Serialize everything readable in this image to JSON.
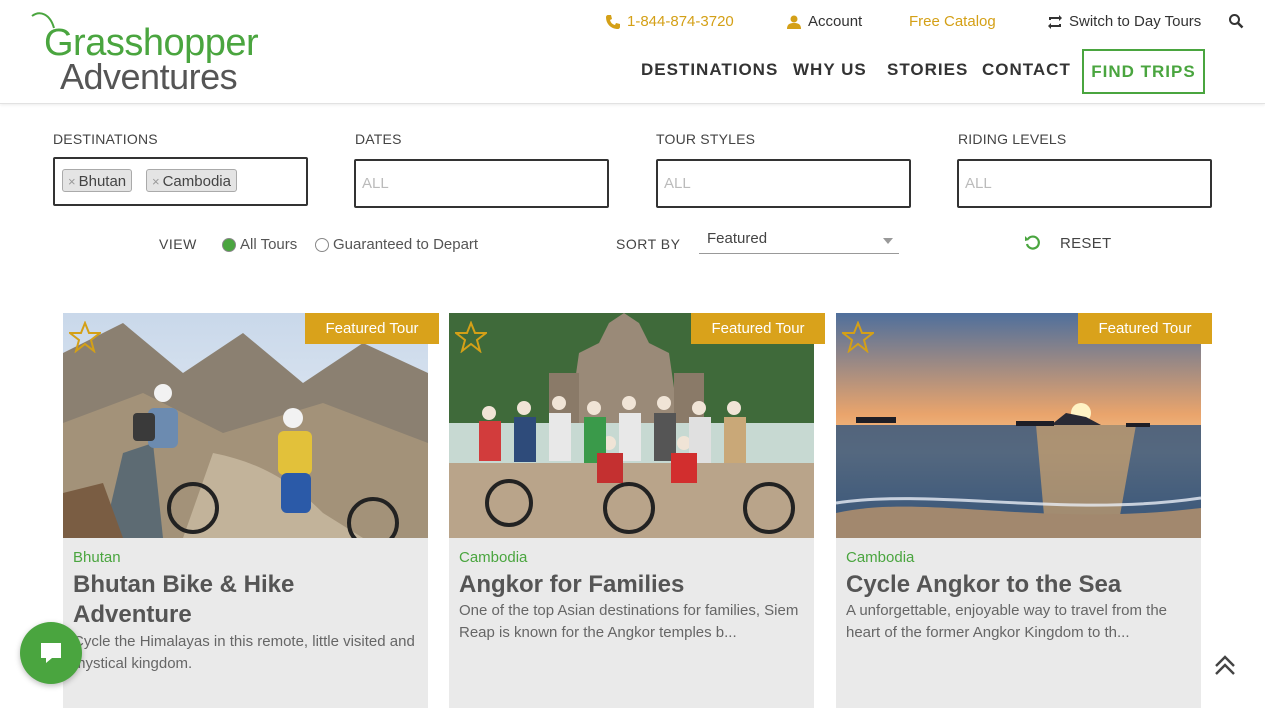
{
  "brand": {
    "line1": "Grasshopper",
    "line2": "Adventures",
    "green": "#4aa53f",
    "gold": "#d4a017"
  },
  "utility": {
    "phone": "1-844-874-3720",
    "account": "Account",
    "catalog": "Free Catalog",
    "switch": "Switch to Day Tours"
  },
  "nav": {
    "items": [
      "DESTINATIONS",
      "WHY US",
      "STORIES",
      "CONTACT"
    ],
    "cta": "FIND TRIPS"
  },
  "filters": {
    "destinations": {
      "label": "DESTINATIONS",
      "tags": [
        "Bhutan",
        "Cambodia"
      ]
    },
    "dates": {
      "label": "DATES",
      "placeholder": "ALL"
    },
    "tour_styles": {
      "label": "TOUR STYLES",
      "placeholder": "ALL"
    },
    "riding_levels": {
      "label": "RIDING LEVELS",
      "placeholder": "ALL"
    }
  },
  "view": {
    "label": "VIEW",
    "options": [
      "All Tours",
      "Guaranteed to Depart"
    ],
    "selected": "All Tours"
  },
  "sort": {
    "label": "SORT BY",
    "value": "Featured"
  },
  "reset": "RESET",
  "cards": [
    {
      "badge": "Featured Tour",
      "country": "Bhutan",
      "title": "Bhutan Bike & Hike Adventure",
      "description": "Cycle the Himalayas in this remote, little visited and mystical kingdom."
    },
    {
      "badge": "Featured Tour",
      "country": "Cambodia",
      "title": "Angkor for Families",
      "description": "One of the top Asian destinations for families, Siem Reap is known for the Angkor temples b..."
    },
    {
      "badge": "Featured Tour",
      "country": "Cambodia",
      "title": "Cycle Angkor to the Sea",
      "description": "A unforgettable, enjoyable way to travel from the heart of the former Angkor Kingdom to th..."
    }
  ]
}
